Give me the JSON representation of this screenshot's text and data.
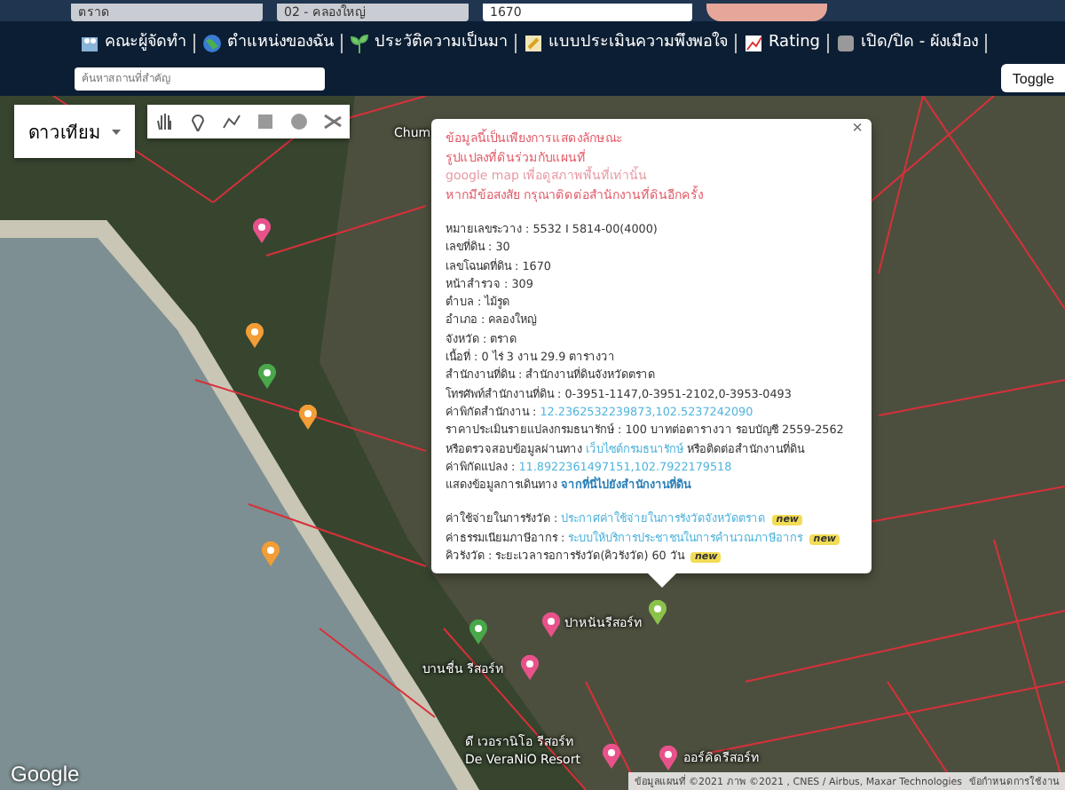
{
  "top_form": {
    "fields": [
      {
        "value": "ตราด"
      },
      {
        "value": "02 - คลองใหญ่"
      },
      {
        "value": "1670"
      }
    ]
  },
  "nav": {
    "items": [
      {
        "kind": "people",
        "label": "คณะผู้จัดทำ"
      },
      {
        "kind": "globe",
        "label": "ตำแหน่งของฉัน"
      },
      {
        "kind": "sprout",
        "label": "ประวัติความเป็นมา"
      },
      {
        "kind": "form",
        "label": "แบบประเมินความพึงพอใจ"
      },
      {
        "kind": "chart",
        "label": "Rating"
      },
      {
        "kind": "square",
        "label": "เปิด/ปิด - ผังเมือง"
      }
    ],
    "search": {
      "placeholder": "ค้นหาสถานที่สำคัญ"
    },
    "toggle": "Toggle"
  },
  "map": {
    "map_type": "ดาวเทียม",
    "labels": [
      {
        "text": "Chum"
      },
      {
        "text": "ปาหนันรีสอร์ท"
      },
      {
        "text": "บานชื่น รีสอร์ท"
      },
      {
        "text": "ดี เวอรานิโอ รีสอร์ท"
      },
      {
        "text": "De VeraNiO Resort"
      },
      {
        "text": "ออร์คิดรีสอร์ท"
      }
    ],
    "attribution": "ข้อมูลแผนที่ ©2021 ภาพ ©2021 , CNES / Airbus, Maxar Technologies",
    "terms": "ข้อกำหนดการใช้งาน",
    "logo": "Google"
  },
  "popup": {
    "close": "×",
    "notice": [
      "ข้อมูลนี้เป็นเพียงการแสดงลักษณะ",
      "รูปแปลงที่ดินร่วมกับแผนที่",
      "google map เพื่อดูสภาพพื้นที่เท่านั้น",
      "หากมีข้อสงสัย กรุณาติดต่อสำนักงานที่ดินอีกครั้ง"
    ],
    "rows": [
      {
        "kind": "text",
        "label": "หมายเลขระวาง : 5532 I 5814-00(4000)"
      },
      {
        "kind": "text",
        "label": "เลขที่ดิน : 30"
      },
      {
        "kind": "text",
        "label": "เลขโฉนดที่ดิน : 1670"
      },
      {
        "kind": "text",
        "label": "หน้าสำรวจ : 309"
      },
      {
        "kind": "text",
        "label": "ตำบล : ไม้รูด"
      },
      {
        "kind": "text",
        "label": "อำเภอ : คลองใหญ่"
      },
      {
        "kind": "text",
        "label": "จังหวัด : ตราด"
      },
      {
        "kind": "text",
        "label": "เนื้อที่ : 0 ไร่ 3 งาน 29.9 ตารางวา"
      },
      {
        "kind": "text",
        "label": "สำนักงานที่ดิน : สำนักงานที่ดินจังหวัดตราด"
      },
      {
        "kind": "text",
        "label": "โทรศัพท์สำนักงานที่ดิน : 0-3951-1147,0-3951-2102,0-3953-0493"
      },
      {
        "kind": "link",
        "label": "ค่าพิกัดสำนักงาน :",
        "link": "12.2362532239873,102.5237242090"
      },
      {
        "kind": "text",
        "label": "ราคาประเมินรายแปลงกรมธนารักษ์ : 100 บาทต่อตารางวา รอบบัญชี 2559-2562"
      },
      {
        "kind": "link",
        "label": "หรือตรวจสอบข้อมูลผ่านทาง",
        "link": "เว็บไซต์กรมธนารักษ์",
        "after": "หรือติดต่อสำนักงานที่ดิน"
      },
      {
        "kind": "link",
        "label": "ค่าพิกัดแปลง :",
        "link": "11.8922361497151,102.7922179518"
      },
      {
        "kind": "route",
        "label": "แสดงข้อมูลการเดินทาง",
        "link": "จากที่นี่ไปยังสำนักงานที่ดิน"
      }
    ],
    "extras": [
      {
        "kind": "link",
        "label": "ค่าใช้จ่ายในการรังวัด :",
        "link": "ประกาศค่าใช้จ่ายในการรังวัดจังหวัดตราด",
        "badge": "new"
      },
      {
        "kind": "link",
        "label": "ค่าธรรมเนียมภาษีอากร :",
        "link": "ระบบให้บริการประชาชนในการคำนวณภาษีอากร",
        "badge": "new"
      },
      {
        "kind": "text",
        "label": "คิวรังวัด : ระยะเวลารอการรังวัด(คิวรังวัด) 60 วัน",
        "badge": "new"
      }
    ]
  }
}
